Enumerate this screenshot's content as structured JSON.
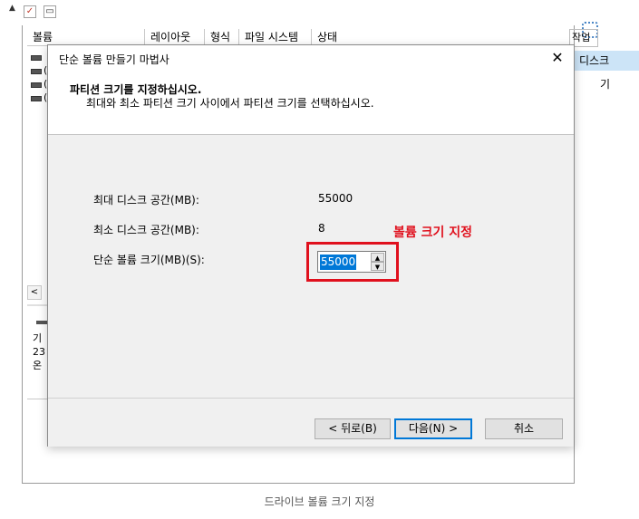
{
  "background": {
    "columns": [
      "볼륨",
      "레이아웃",
      "형식",
      "파일 시스템",
      "상태"
    ],
    "right_panel": {
      "header": "작업",
      "selected": "디스크",
      "sub": "기"
    },
    "disk_info": [
      "기",
      "23",
      "온"
    ]
  },
  "wizard": {
    "title": "단순 볼륨 만들기 마법사",
    "close_glyph": "✕",
    "heading": "파티션 크기를 지정하십시오.",
    "subheading": "최대와 최소 파티션 크기 사이에서 파티션 크기를 선택하십시오.",
    "fields": {
      "max_label": "최대 디스크 공간(MB):",
      "max_value": "55000",
      "min_label": "최소 디스크 공간(MB):",
      "min_value": "8",
      "size_label": "단순 볼륨 크기(MB)(S):",
      "size_value": "55000"
    },
    "annotation": "볼륨 크기 지정",
    "buttons": {
      "back": "< 뒤로(B)",
      "next": "다음(N) >",
      "cancel": "취소"
    }
  },
  "caption": "드라이브 볼륨 크기 지정"
}
